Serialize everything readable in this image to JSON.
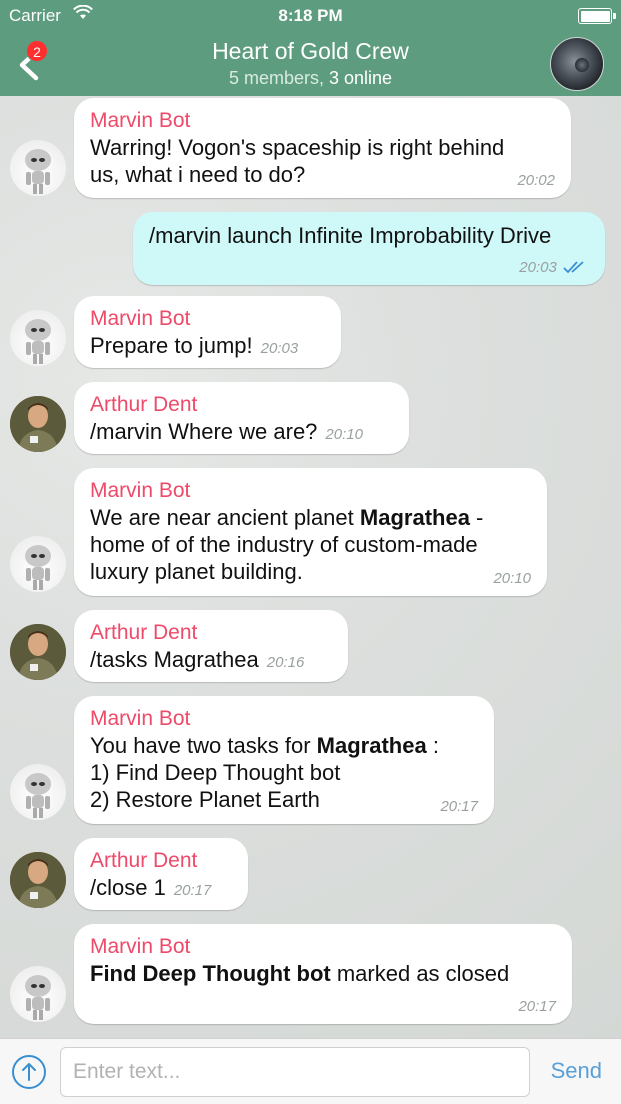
{
  "status_bar": {
    "carrier": "Carrier",
    "time": "8:18 PM"
  },
  "header": {
    "back_badge": "2",
    "title": "Heart of Gold Crew",
    "members": "5 members,",
    "online": "3 online"
  },
  "messages": [
    {
      "sender": "Marvin Bot",
      "parts": [
        "Warring! Vogon's spaceship is right behind\nus, what i need to do?"
      ],
      "time": "20:02",
      "avatar": "robot-avatar"
    },
    {
      "sender": "",
      "parts": [
        "/marvin launch Infinite Improbability Drive"
      ],
      "time": "20:03",
      "outgoing": true,
      "read_ticks": "double-check-icon"
    },
    {
      "sender": "Marvin Bot",
      "parts": [
        "Prepare to jump!"
      ],
      "time": "20:03",
      "avatar": "robot-avatar"
    },
    {
      "sender": "Arthur Dent",
      "parts": [
        "/marvin Where we are?"
      ],
      "time": "20:10",
      "avatar": "arthur-avatar"
    },
    {
      "sender": "Marvin Bot",
      "parts": [
        "We are near ancient planet ",
        "Magrathea",
        " -\nhome of of the industry of custom-made\nluxury planet building."
      ],
      "time": "20:10",
      "avatar": "robot-avatar"
    },
    {
      "sender": "Arthur Dent",
      "parts": [
        "/tasks Magrathea"
      ],
      "time": "20:16",
      "avatar": "arthur-avatar"
    },
    {
      "sender": "Marvin Bot",
      "parts": [
        "You have two tasks for ",
        "Magrathea",
        " :\n1) Find Deep Thought bot\n2) Restore Planet Earth"
      ],
      "time": "20:17",
      "avatar": "robot-avatar"
    },
    {
      "sender": "Arthur Dent",
      "parts": [
        "/close 1"
      ],
      "time": "20:17",
      "avatar": "arthur-avatar"
    },
    {
      "sender": "Marvin Bot",
      "parts": [
        "",
        "Find Deep Thought bot",
        " marked as closed"
      ],
      "time": "20:17",
      "avatar": "robot-avatar"
    }
  ],
  "input": {
    "placeholder": "Enter text...",
    "send_label": "Send"
  },
  "colors": {
    "header": "#5d9c7e",
    "sender": "#ee4a6a",
    "outgoing_bubble": "#cff8f8",
    "accent": "#3a8fd0"
  }
}
